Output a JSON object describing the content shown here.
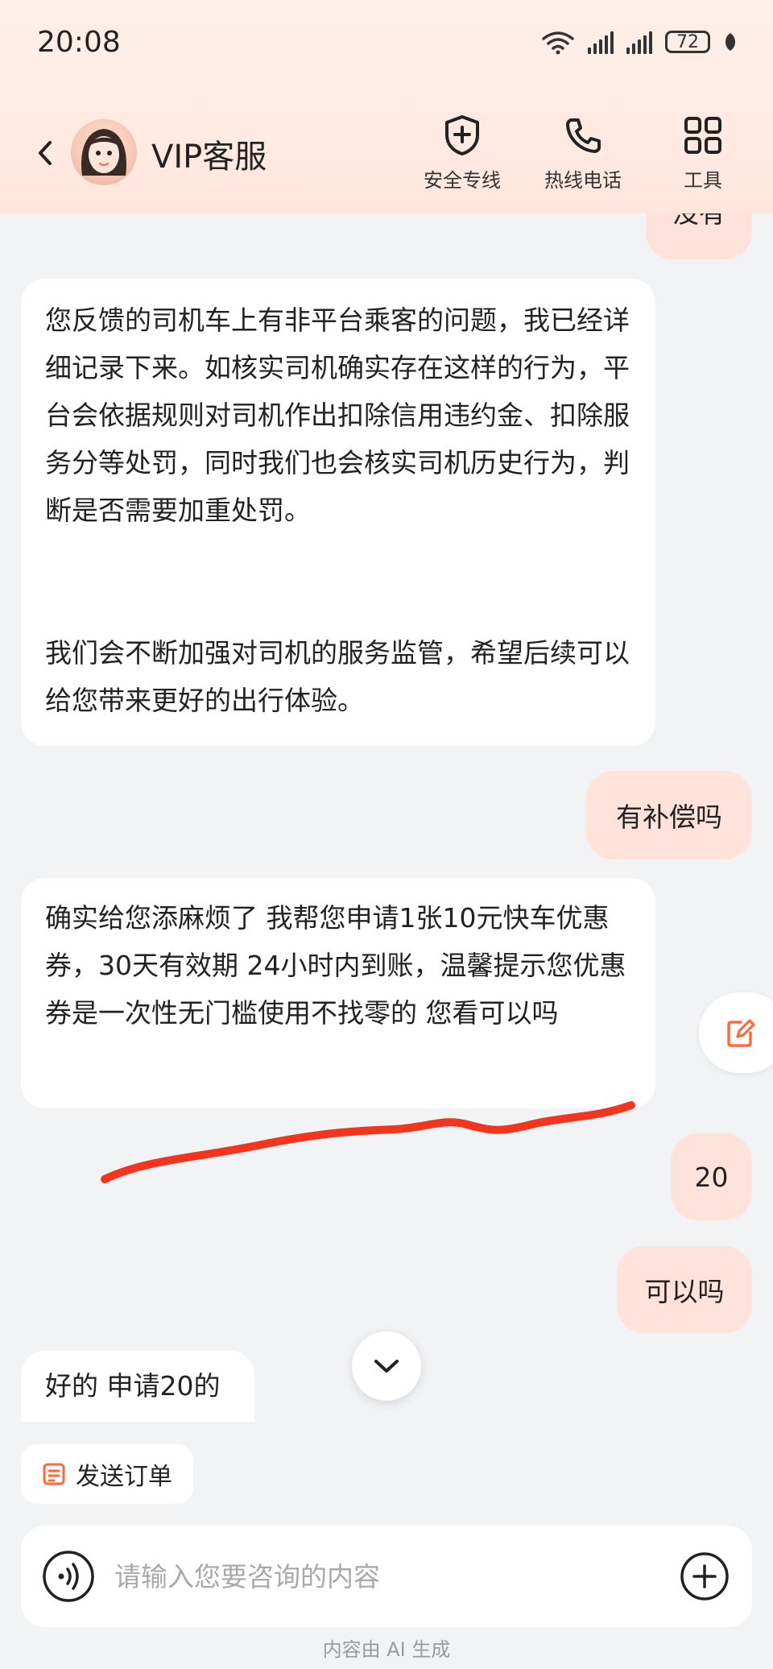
{
  "status_bar": {
    "time": "20:08",
    "battery": "72"
  },
  "header": {
    "title": "VIP客服",
    "tools": [
      {
        "label": "安全专线",
        "icon": "shield-plus-icon"
      },
      {
        "label": "热线电话",
        "icon": "phone-icon"
      },
      {
        "label": "工具",
        "icon": "grid-icon"
      }
    ]
  },
  "messages": {
    "partial_top": "没有",
    "agent_1": {
      "p1": "您反馈的司机车上有非平台乘客的问题，我已经详细记录下来。如核实司机确实存在这样的行为，平台会依据规则对司机作出扣除信用违约金、扣除服务分等处罚，同时我们也会核实司机历史行为，判断是否需要加重处罚。",
      "p2": "我们会不断加强对司机的服务监管，希望后续可以给您带来更好的出行体验。"
    },
    "user_1": "有补偿吗",
    "agent_2": "确实给您添麻烦了 我帮您申请1张10元快车优惠券，30天有效期 24小时内到账，温馨提示您优惠券是一次性无门槛使用不找零的 您看可以吗",
    "user_2": "20",
    "user_3": "可以吗",
    "agent_3": "好的 申请20的"
  },
  "actions": {
    "send_order": "发送订单"
  },
  "input": {
    "placeholder": "请输入您要咨询的内容"
  },
  "footer": "内容由 AI 生成",
  "colors": {
    "accent": "#ff6a3d",
    "user_bubble": "#ffe3da",
    "annotation": "#f2351e"
  }
}
